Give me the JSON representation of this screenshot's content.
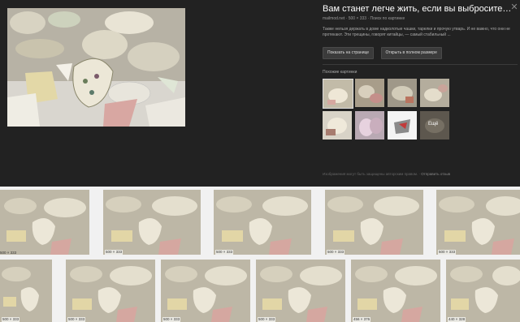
{
  "preview": {
    "title": "Вам станет легче жить, если вы выбросите из дома ...",
    "site": "mailmod.net",
    "dimensions": "500 × 333",
    "search_by_image": "Поиск по картинке",
    "description": "Также нельзя держать в доме надколотые чашки, тарелки и прочую утварь. И не важно, что они не протекают. Эти трещины, говорят китайцы, — самый стабильный ...",
    "open_page_label": "Показать на странице",
    "open_full_label": "Открыть в полном размере",
    "similar_label": "Похожие картинки",
    "similar_more_label": "Ещё",
    "footer_notice": "Изображения могут быть защищены авторским правом.",
    "feedback_label": "Отправить отзыв",
    "close_icon": "close-icon"
  },
  "results_row1": [
    {
      "caption": "500 × 333"
    },
    {
      "caption": "500 × 333"
    },
    {
      "caption": "500 × 333"
    },
    {
      "caption": "500 × 333"
    },
    {
      "caption": "500 × 333"
    }
  ],
  "results_row2": [
    {
      "caption": "500 × 333"
    },
    {
      "caption": "500 × 333"
    },
    {
      "caption": "500 × 333"
    },
    {
      "caption": "500 × 333"
    },
    {
      "caption": "456 × 376"
    },
    {
      "caption": "440 × 328"
    }
  ],
  "results_row0_partial": [
    {
      "caption": "500 × 333"
    }
  ]
}
